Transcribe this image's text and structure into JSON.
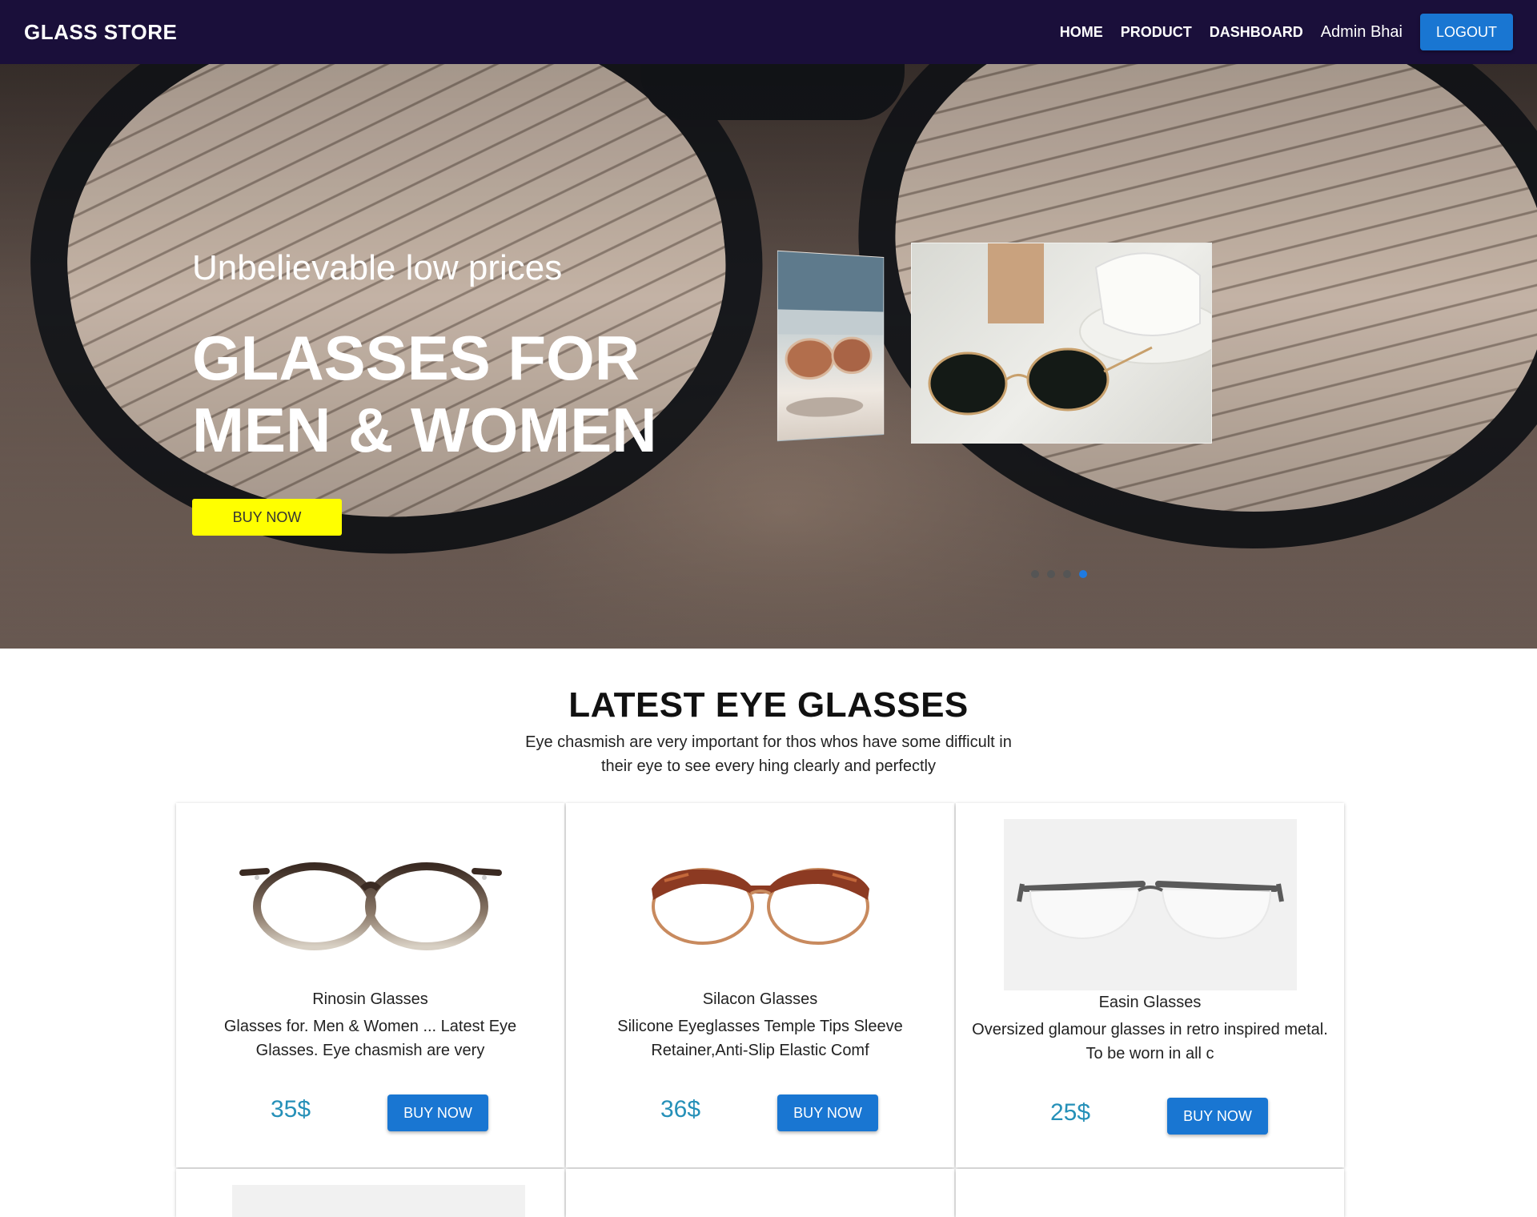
{
  "navbar": {
    "brand": "GLASS STORE",
    "links": [
      "HOME",
      "PRODUCT",
      "DASHBOARD"
    ],
    "user": "Admin Bhai",
    "logout": "LOGOUT"
  },
  "hero": {
    "tagline": "Unbelievable low prices",
    "title": "GLASSES FOR MEN & WOMEN",
    "button": "BUY NOW",
    "carousel_dots": 4,
    "active_dot": 4
  },
  "section": {
    "title": "LATEST EYE GLASSES",
    "subtitle": "Eye chasmish are very important for thos whos have some difficult in their eye to see every hing clearly and perfectly"
  },
  "products": [
    {
      "name": "Rinosin Glasses",
      "description": "Glasses for. Men & Women ... Latest Eye Glasses. Eye chasmish are very",
      "price": "35$",
      "button": "BUY NOW",
      "image_icon": "round-tortoise-glasses-icon"
    },
    {
      "name": "Silacon Glasses",
      "description": "Silicone Eyeglasses Temple Tips Sleeve Retainer,Anti-Slip Elastic Comf",
      "price": "36$",
      "button": "BUY NOW",
      "image_icon": "browline-glasses-icon"
    },
    {
      "name": "Easin Glasses",
      "description": "Oversized glamour glasses in retro inspired metal. To be worn in all c",
      "price": "25$",
      "button": "BUY NOW",
      "image_icon": "half-rim-glasses-icon"
    }
  ],
  "colors": {
    "navbar_bg": "#1a0f3a",
    "primary_button": "#1976d2",
    "hero_button": "#ffff00",
    "price": "#2590b8"
  }
}
